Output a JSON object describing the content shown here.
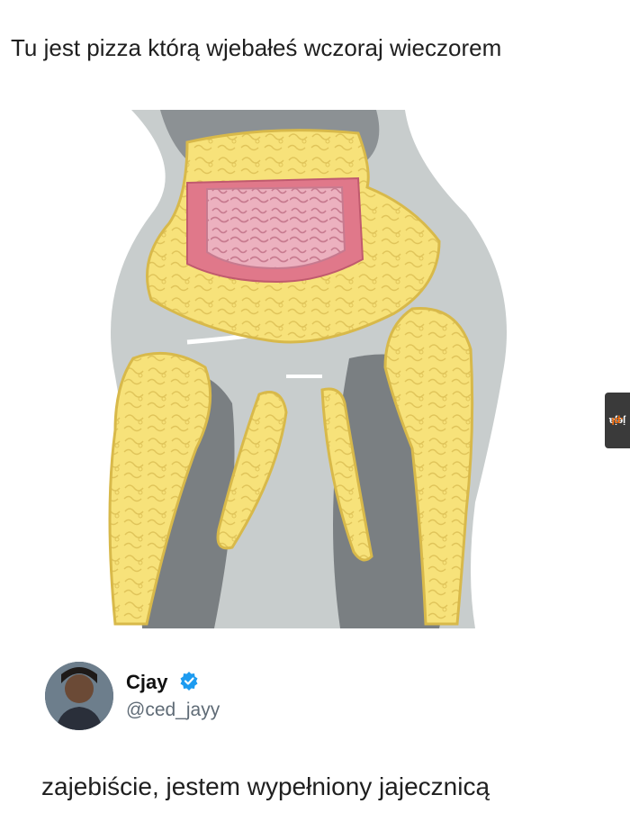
{
  "caption": "Tu jest pizza którą wjebałeś wczoraj wieczorem",
  "watermark": {
    "brand": "jeja",
    "tld": ".pl"
  },
  "tweet": {
    "name": "Cjay",
    "handle": "@ced_jayy",
    "verified": true,
    "text": "zajebiście, jestem wypełniony jajecznicą"
  },
  "colors": {
    "fat_yellow": "#f7e27a",
    "fat_outline": "#d8b94a",
    "intestine_pink": "#e6a3b3",
    "colon_pink": "#e0788a",
    "muscle_gray": "#7a7f82",
    "body_light": "#c8cdcd",
    "verified_blue": "#1d9bf0"
  },
  "icons": [
    "verified-badge-icon",
    "avatar-image",
    "anatomy-illustration"
  ]
}
